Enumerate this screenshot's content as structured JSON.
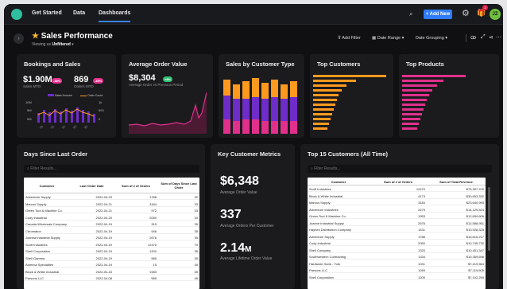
{
  "nav": {
    "tabs": [
      "Get Started",
      "Data",
      "Dashboards"
    ],
    "add_new": "+ Add New",
    "badge_count": "2",
    "avatar_initials": "JZ"
  },
  "page": {
    "title": "Sales Performance",
    "viewing_prefix": "Viewing as",
    "viewing_value": "Unfiltered",
    "add_filter": "Add Filter",
    "date_range": "Date Range",
    "date_grouping": "Date Grouping"
  },
  "bookings": {
    "title": "Bookings and Sales",
    "sales_value": "$1.90M",
    "sales_change": "-38%",
    "sales_sub": "Sales MTD",
    "orders_value": "869",
    "orders_change": "-39%",
    "orders_sub": "Orders MTD",
    "legend_a": "Sales Amount",
    "legend_b": "Order Count",
    "ylabel_left": "Sales Amount",
    "ylabel_right": "Order Count",
    "y_left_ticks": [
      "10M",
      "5M",
      "0M"
    ],
    "y_right_ticks": [
      "1k",
      "500",
      "0"
    ]
  },
  "aov": {
    "title": "Average Order Value",
    "value": "$8,304",
    "change": "+8%",
    "sub": "Average Order vs Previous Period"
  },
  "sbct": {
    "title": "Sales by Customer Type"
  },
  "top_customers": {
    "title": "Top Customers"
  },
  "top_products": {
    "title": "Top Products"
  },
  "days": {
    "title": "Days Since Last Order",
    "search_placeholder": "Filter Results...",
    "headers": [
      "Customer",
      "Last Order Date",
      "Sum of # of Orders",
      "Sum of Days Since Last Order"
    ],
    "rows": [
      [
        "Adventure Supply",
        "2022-04-23",
        "1786",
        "32"
      ],
      [
        "Marcus Supply",
        "2022-04-21",
        "3184",
        "33"
      ],
      [
        "Green Tool & Machine Co.",
        "2022-04-21",
        "972",
        "33"
      ],
      [
        "Cody Industrial",
        "2022-04-20",
        "2050",
        "34"
      ],
      [
        "Canada Wholesale Company",
        "2022-04-19",
        "315",
        "35"
      ],
      [
        "Chromatox",
        "2022-04-19",
        "946",
        "35"
      ],
      [
        "Joanna Industrial Supply",
        "2022-04-19",
        "2676",
        "35"
      ],
      [
        "Scott Industries",
        "2022-04-19",
        "12470",
        "70"
      ],
      [
        "Shell Corporation",
        "2022-04-19",
        "1200",
        "35"
      ],
      [
        "Shell Gamma",
        "2022-04-19",
        "585",
        "35"
      ],
      [
        "America Specialties",
        "2022-04-19",
        "15",
        "35"
      ],
      [
        "Block & White Industrial",
        "2022-04-15",
        "1983",
        "39"
      ],
      [
        "Parsons LLC",
        "2022-04-08",
        "585",
        "45"
      ]
    ]
  },
  "kcm": {
    "title": "Key Customer Metrics",
    "avg_order_value": "$6,348",
    "avg_order_label": "Average Order Value",
    "avg_orders": "337",
    "avg_orders_label": "Average Orders Per Customer",
    "lifetime_value": "2.14",
    "lifetime_suffix": "M",
    "lifetime_label": "Average Lifetime Order Value"
  },
  "top15": {
    "title": "Top 15 Customers (All Time)",
    "search_placeholder": "Filter Results...",
    "headers": [
      "Customer",
      "Sum of # of Orders",
      "Sum of Total Revenue"
    ],
    "rows": [
      [
        "Scott Industries",
        "12470",
        "$79,357,376"
      ],
      [
        "Block & White Industrial",
        "4173",
        "$30,653,332"
      ],
      [
        "Marcus Supply",
        "3184",
        "$23,640,993"
      ],
      [
        "Adventure Industries",
        "2475",
        "$14,129,524"
      ],
      [
        "Green Tool & Machine Co.",
        "1953",
        "$12,650,606"
      ],
      [
        "Joanne Industrial Supply",
        "2676",
        "$12,588,951"
      ],
      [
        "Haynes Distribution Company",
        "1431",
        "$10,928,325"
      ],
      [
        "Adventure Supply",
        "1786",
        "$10,816,217"
      ],
      [
        "Cody Industrial",
        "2050",
        "$10,745,732"
      ],
      [
        "Shell Company",
        "1320",
        "$10,451,347"
      ],
      [
        "Southwestern Contracting",
        "1334",
        "$10,359,698"
      ],
      [
        "Hardware Hank - York",
        "1031",
        "$7,219,564"
      ],
      [
        "Parsons LLC",
        "1269",
        "$7,115,605"
      ],
      [
        "Shell Corporation",
        "1200",
        "$7,102,250"
      ]
    ]
  },
  "colors": {
    "accent": "#2f7cf6",
    "orange": "#ff9a1f",
    "purple": "#6e2cc9",
    "magenta": "#e0308c",
    "green": "#2fbf71"
  }
}
